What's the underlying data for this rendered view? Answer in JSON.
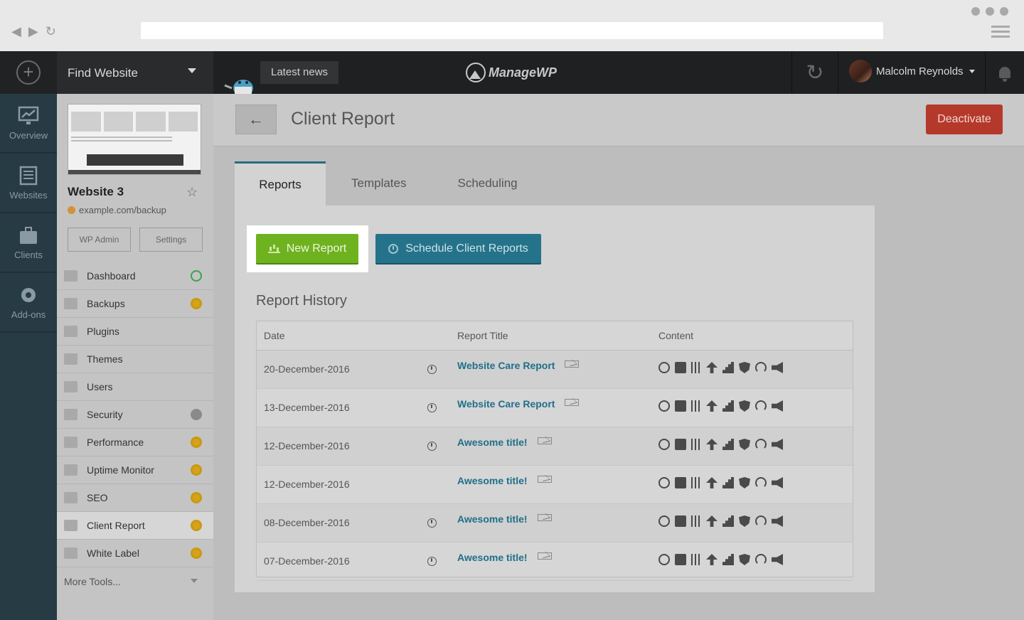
{
  "header": {
    "find_website": "Find Website",
    "latest_news": "Latest news",
    "logo_text": "ManageWP",
    "user_name": "Malcolm Reynolds"
  },
  "rail": [
    {
      "label": "Overview",
      "icon": "overview-icon"
    },
    {
      "label": "Websites",
      "icon": "websites-icon"
    },
    {
      "label": "Clients",
      "icon": "clients-icon"
    },
    {
      "label": "Add-ons",
      "icon": "addons-icon"
    }
  ],
  "site": {
    "name": "Website 3",
    "url": "example.com/backup",
    "wp_admin": "WP Admin",
    "settings": "Settings"
  },
  "menu": [
    {
      "label": "Dashboard",
      "badge": "green"
    },
    {
      "label": "Backups",
      "badge": "gold"
    },
    {
      "label": "Plugins",
      "badge": ""
    },
    {
      "label": "Themes",
      "badge": ""
    },
    {
      "label": "Users",
      "badge": ""
    },
    {
      "label": "Security",
      "badge": "grey"
    },
    {
      "label": "Performance",
      "badge": "gold"
    },
    {
      "label": "Uptime Monitor",
      "badge": "gold"
    },
    {
      "label": "SEO",
      "badge": "gold"
    },
    {
      "label": "Client Report",
      "badge": "gold",
      "active": true
    },
    {
      "label": "White Label",
      "badge": "gold"
    }
  ],
  "more_tools": "More Tools...",
  "main": {
    "title": "Client Report",
    "deactivate": "Deactivate",
    "tabs": [
      "Reports",
      "Templates",
      "Scheduling"
    ],
    "new_report": "New Report",
    "schedule": "Schedule Client Reports",
    "history_title": "Report History",
    "columns": {
      "date": "Date",
      "title": "Report Title",
      "content": "Content"
    },
    "rows": [
      {
        "date": "20-December-2016",
        "title": "Website Care Report",
        "scheduled": true
      },
      {
        "date": "13-December-2016",
        "title": "Website Care Report",
        "scheduled": true
      },
      {
        "date": "12-December-2016",
        "title": "Awesome title!",
        "scheduled": true
      },
      {
        "date": "12-December-2016",
        "title": "Awesome title!",
        "scheduled": false
      },
      {
        "date": "08-December-2016",
        "title": "Awesome title!",
        "scheduled": true
      },
      {
        "date": "07-December-2016",
        "title": "Awesome title!",
        "scheduled": true
      }
    ],
    "content_icons": [
      "sync-icon",
      "backup-icon",
      "plugins-icon",
      "uptime-icon",
      "analytics-icon",
      "security-icon",
      "performance-icon",
      "seo-icon"
    ]
  },
  "colors": {
    "accent_green": "#6fb21f",
    "accent_teal": "#25738a",
    "danger": "#b5392a",
    "link": "#1f6f8a"
  }
}
